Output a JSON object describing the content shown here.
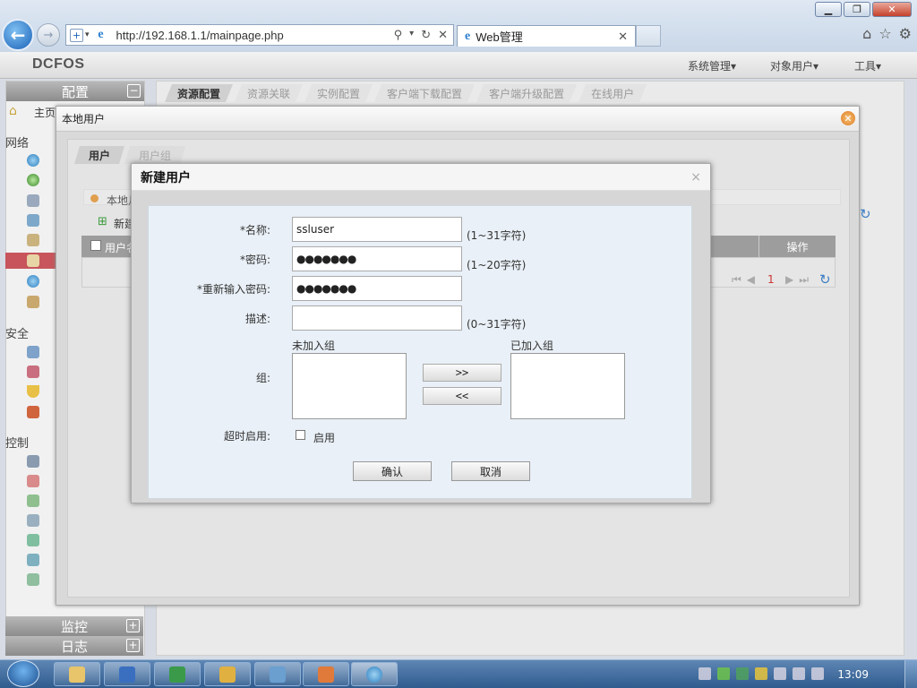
{
  "browser": {
    "url": "http://192.168.1.1/mainpage.php",
    "tab_title": "Web管理",
    "tab_close": "✕"
  },
  "app": {
    "logo": "DCFOS",
    "menu": [
      "系统管理▾",
      "对象用户▾",
      "工具▾"
    ]
  },
  "sidebar": {
    "header": "配置",
    "header_toggle": "−",
    "home_label": "主页",
    "sections": [
      "网络",
      "安全",
      "控制"
    ],
    "bottom_headers": [
      {
        "label": "监控",
        "toggle": "+"
      },
      {
        "label": "日志",
        "toggle": "+"
      }
    ]
  },
  "main_tabs": [
    "资源配置",
    "资源关联",
    "实例配置",
    "客户端下载配置",
    "客户端升级配置",
    "在线用户"
  ],
  "local_users": {
    "title": "本地用户",
    "close": "✕",
    "tabs": [
      "用户",
      "用户组"
    ],
    "breadcrumb": "本地月",
    "new_label": "新建",
    "grid_user_col": "用户名",
    "grid_op_col": "操作",
    "pager_page": "1"
  },
  "new_user_dialog": {
    "title": "新建用户",
    "close": "×",
    "fields": {
      "name_label": "*名称:",
      "name_value": "ssluser",
      "name_hint": "(1~31字符)",
      "password_label": "*密码:",
      "password_value": "●●●●●●●",
      "password_hint": "(1~20字符)",
      "repeat_label": "*重新输入密码:",
      "repeat_value": "●●●●●●●",
      "desc_label": "描述:",
      "desc_value": "",
      "desc_hint": "(0~31字符)"
    },
    "group": {
      "label": "组:",
      "available_title": "未加入组",
      "joined_title": "已加入组",
      "add_button": ">>",
      "remove_button": "<<"
    },
    "timeout": {
      "label": "超时启用:",
      "checkbox_label": "启用",
      "checked": false
    },
    "buttons": {
      "confirm": "确认",
      "cancel": "取消"
    }
  },
  "taskbar": {
    "clock": "13:09"
  },
  "colors": {
    "sidebar_selected": "#c7555b",
    "taskbar": "#2f5b8e",
    "dialog_body": "#e9f0f7"
  }
}
